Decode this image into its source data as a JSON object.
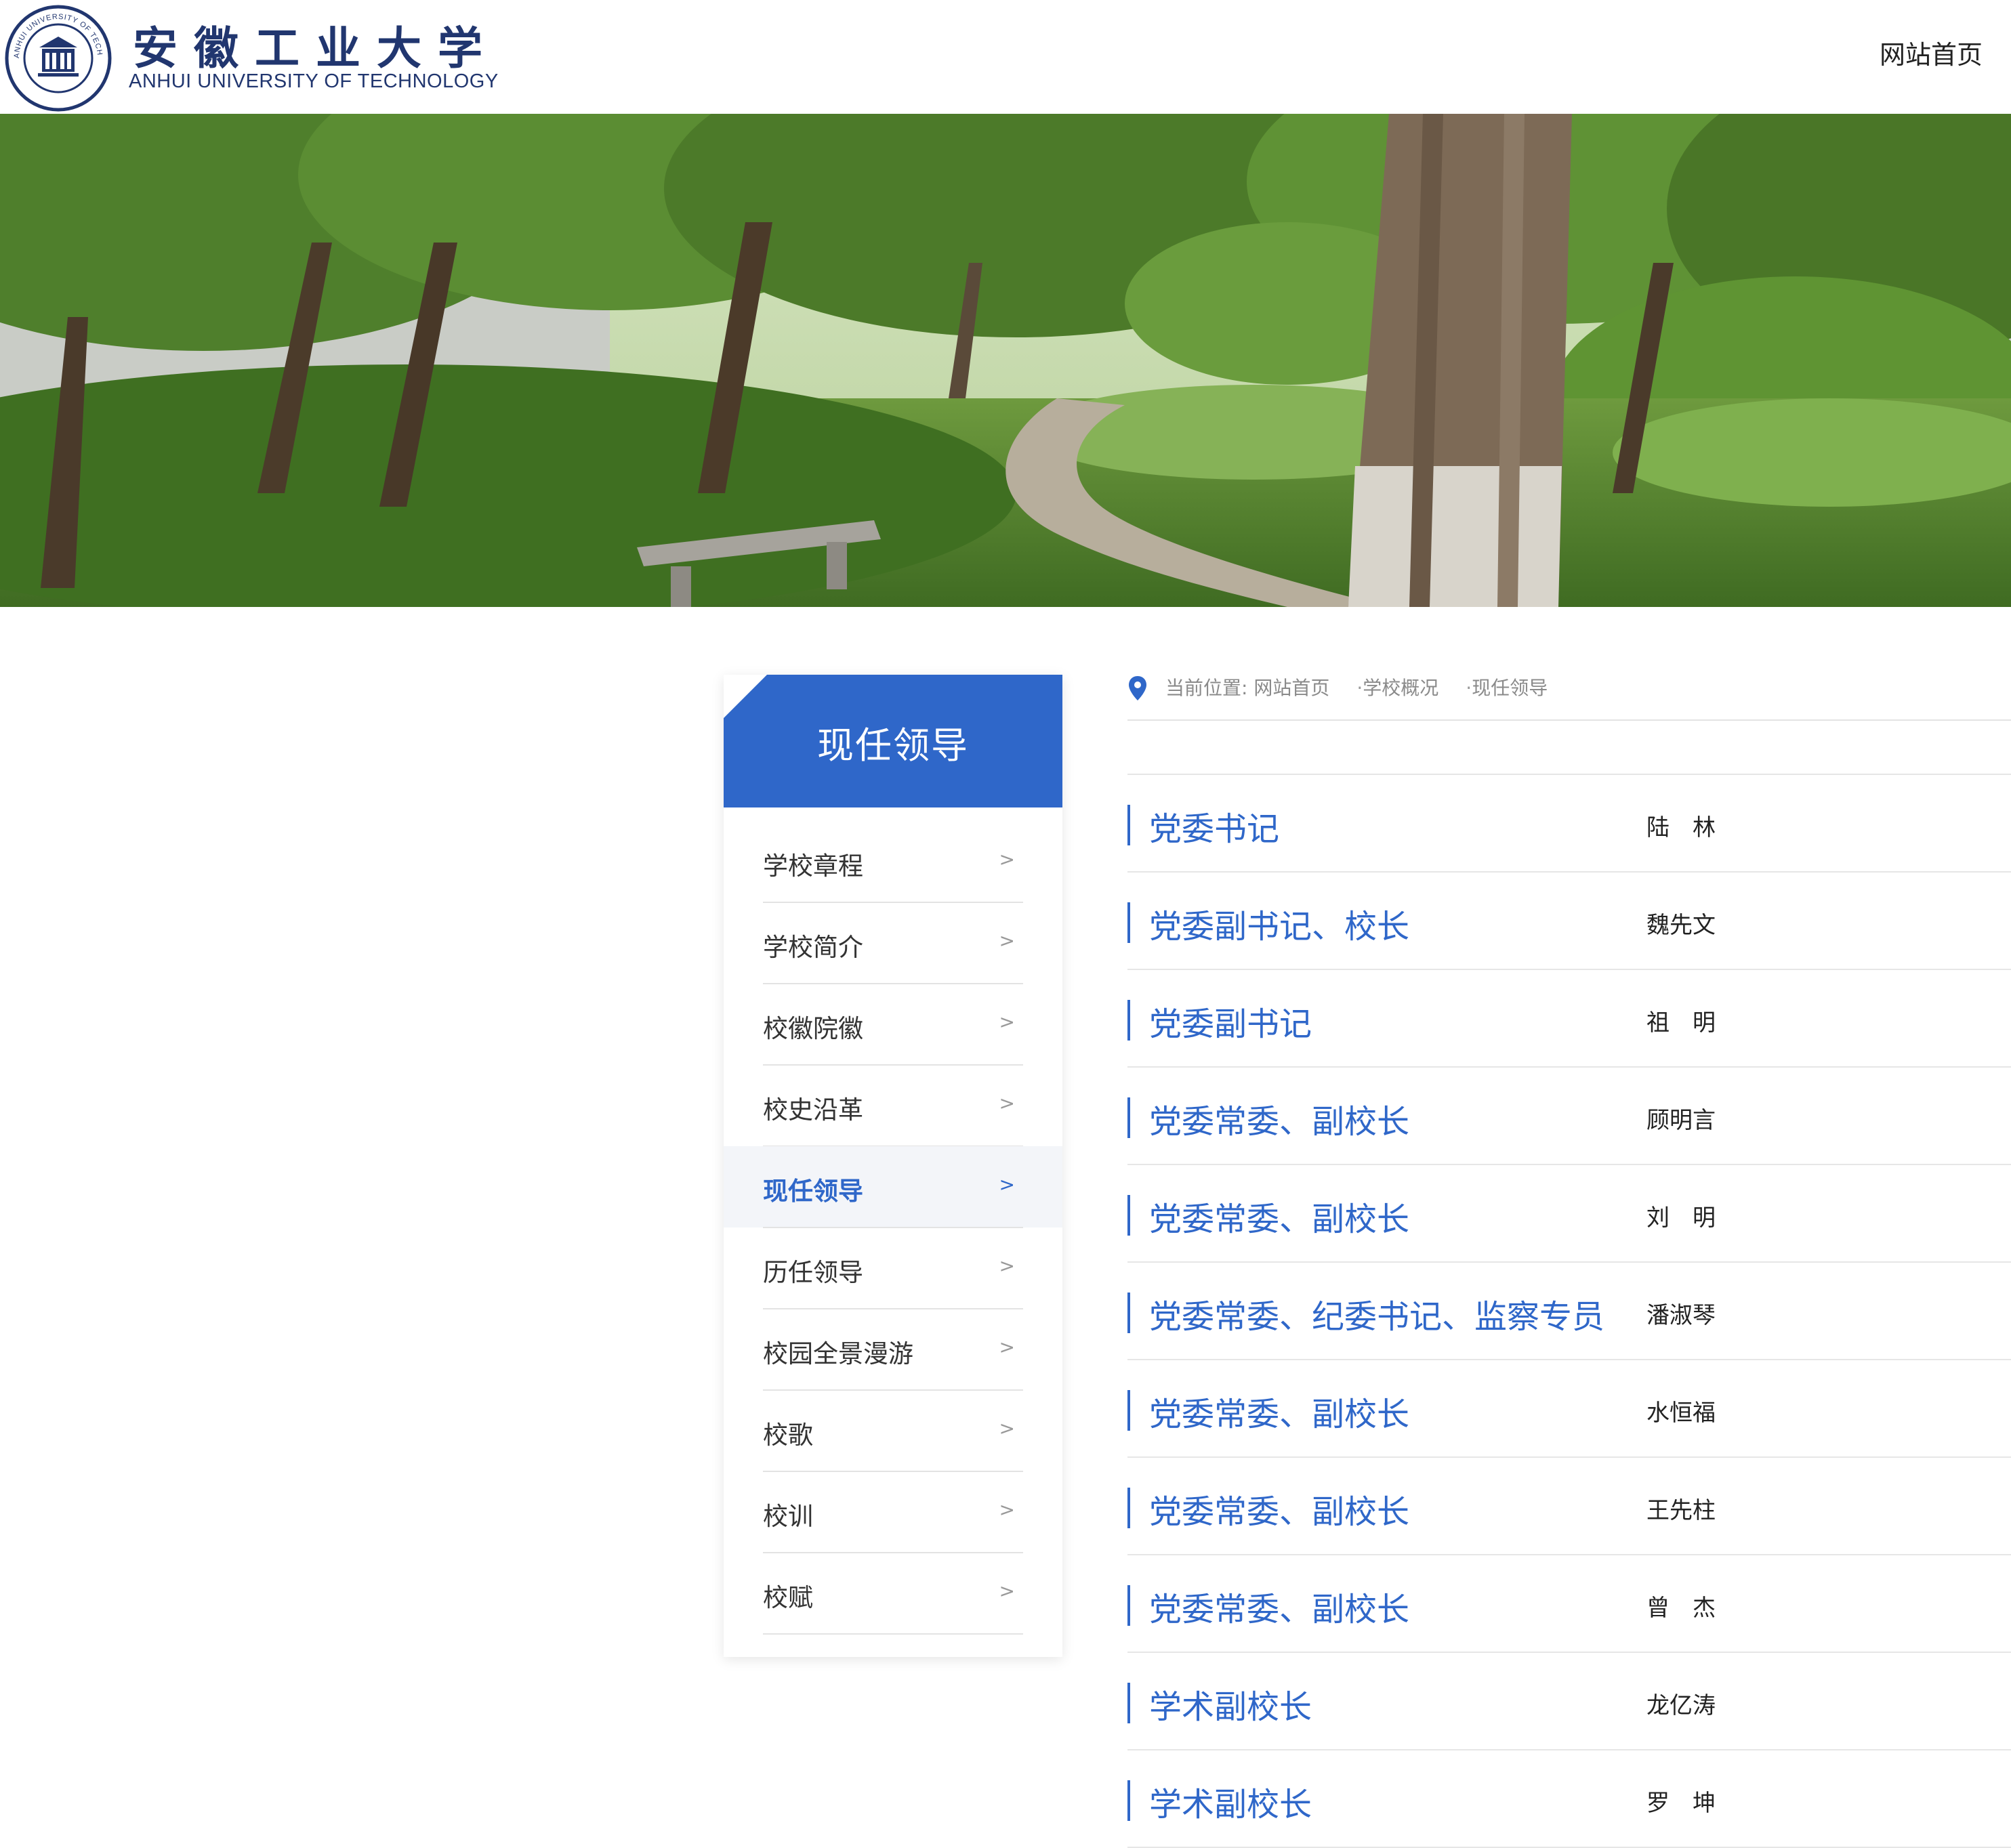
{
  "header": {
    "logo_cn": "安徽工业大学",
    "logo_en": "ANHUI UNIVERSITY OF TECHNOLOGY",
    "seal_text": "ANHUI UNIVERSITY OF TECHNOLOGY",
    "home_link": "网站首页"
  },
  "sidebar": {
    "title": "现任领导",
    "items": [
      {
        "label": "学校章程",
        "arrow": ">"
      },
      {
        "label": "学校简介",
        "arrow": ">"
      },
      {
        "label": "校徽院徽",
        "arrow": ">"
      },
      {
        "label": "校史沿革",
        "arrow": ">"
      },
      {
        "label": "现任领导",
        "arrow": ">"
      },
      {
        "label": "历任领导",
        "arrow": ">"
      },
      {
        "label": "校园全景漫游",
        "arrow": ">"
      },
      {
        "label": "校歌",
        "arrow": ">"
      },
      {
        "label": "校训",
        "arrow": ">"
      },
      {
        "label": "校赋",
        "arrow": ">"
      }
    ],
    "active_index": 4
  },
  "breadcrumb": {
    "prefix": "当前位置: ",
    "items": [
      "网站首页",
      "学校概况",
      "现任领导"
    ],
    "separator": "·"
  },
  "leaders": [
    {
      "title": "党委书记",
      "name": "陆　林"
    },
    {
      "title": "党委副书记、校长",
      "name": "魏先文"
    },
    {
      "title": "党委副书记",
      "name": "祖　明"
    },
    {
      "title": "党委常委、副校长",
      "name": "顾明言"
    },
    {
      "title": "党委常委、副校长",
      "name": "刘　明"
    },
    {
      "title": "党委常委、纪委书记、监察专员",
      "name": "潘淑琴"
    },
    {
      "title": "党委常委、副校长",
      "name": "水恒福"
    },
    {
      "title": "党委常委、副校长",
      "name": "王先柱"
    },
    {
      "title": "党委常委、副校长",
      "name": "曾　杰"
    },
    {
      "title": "学术副校长",
      "name": "龙亿涛"
    },
    {
      "title": "学术副校长",
      "name": "罗　坤"
    }
  ],
  "colors": {
    "accent": "#2f67c9",
    "brand_navy": "#21366f"
  }
}
